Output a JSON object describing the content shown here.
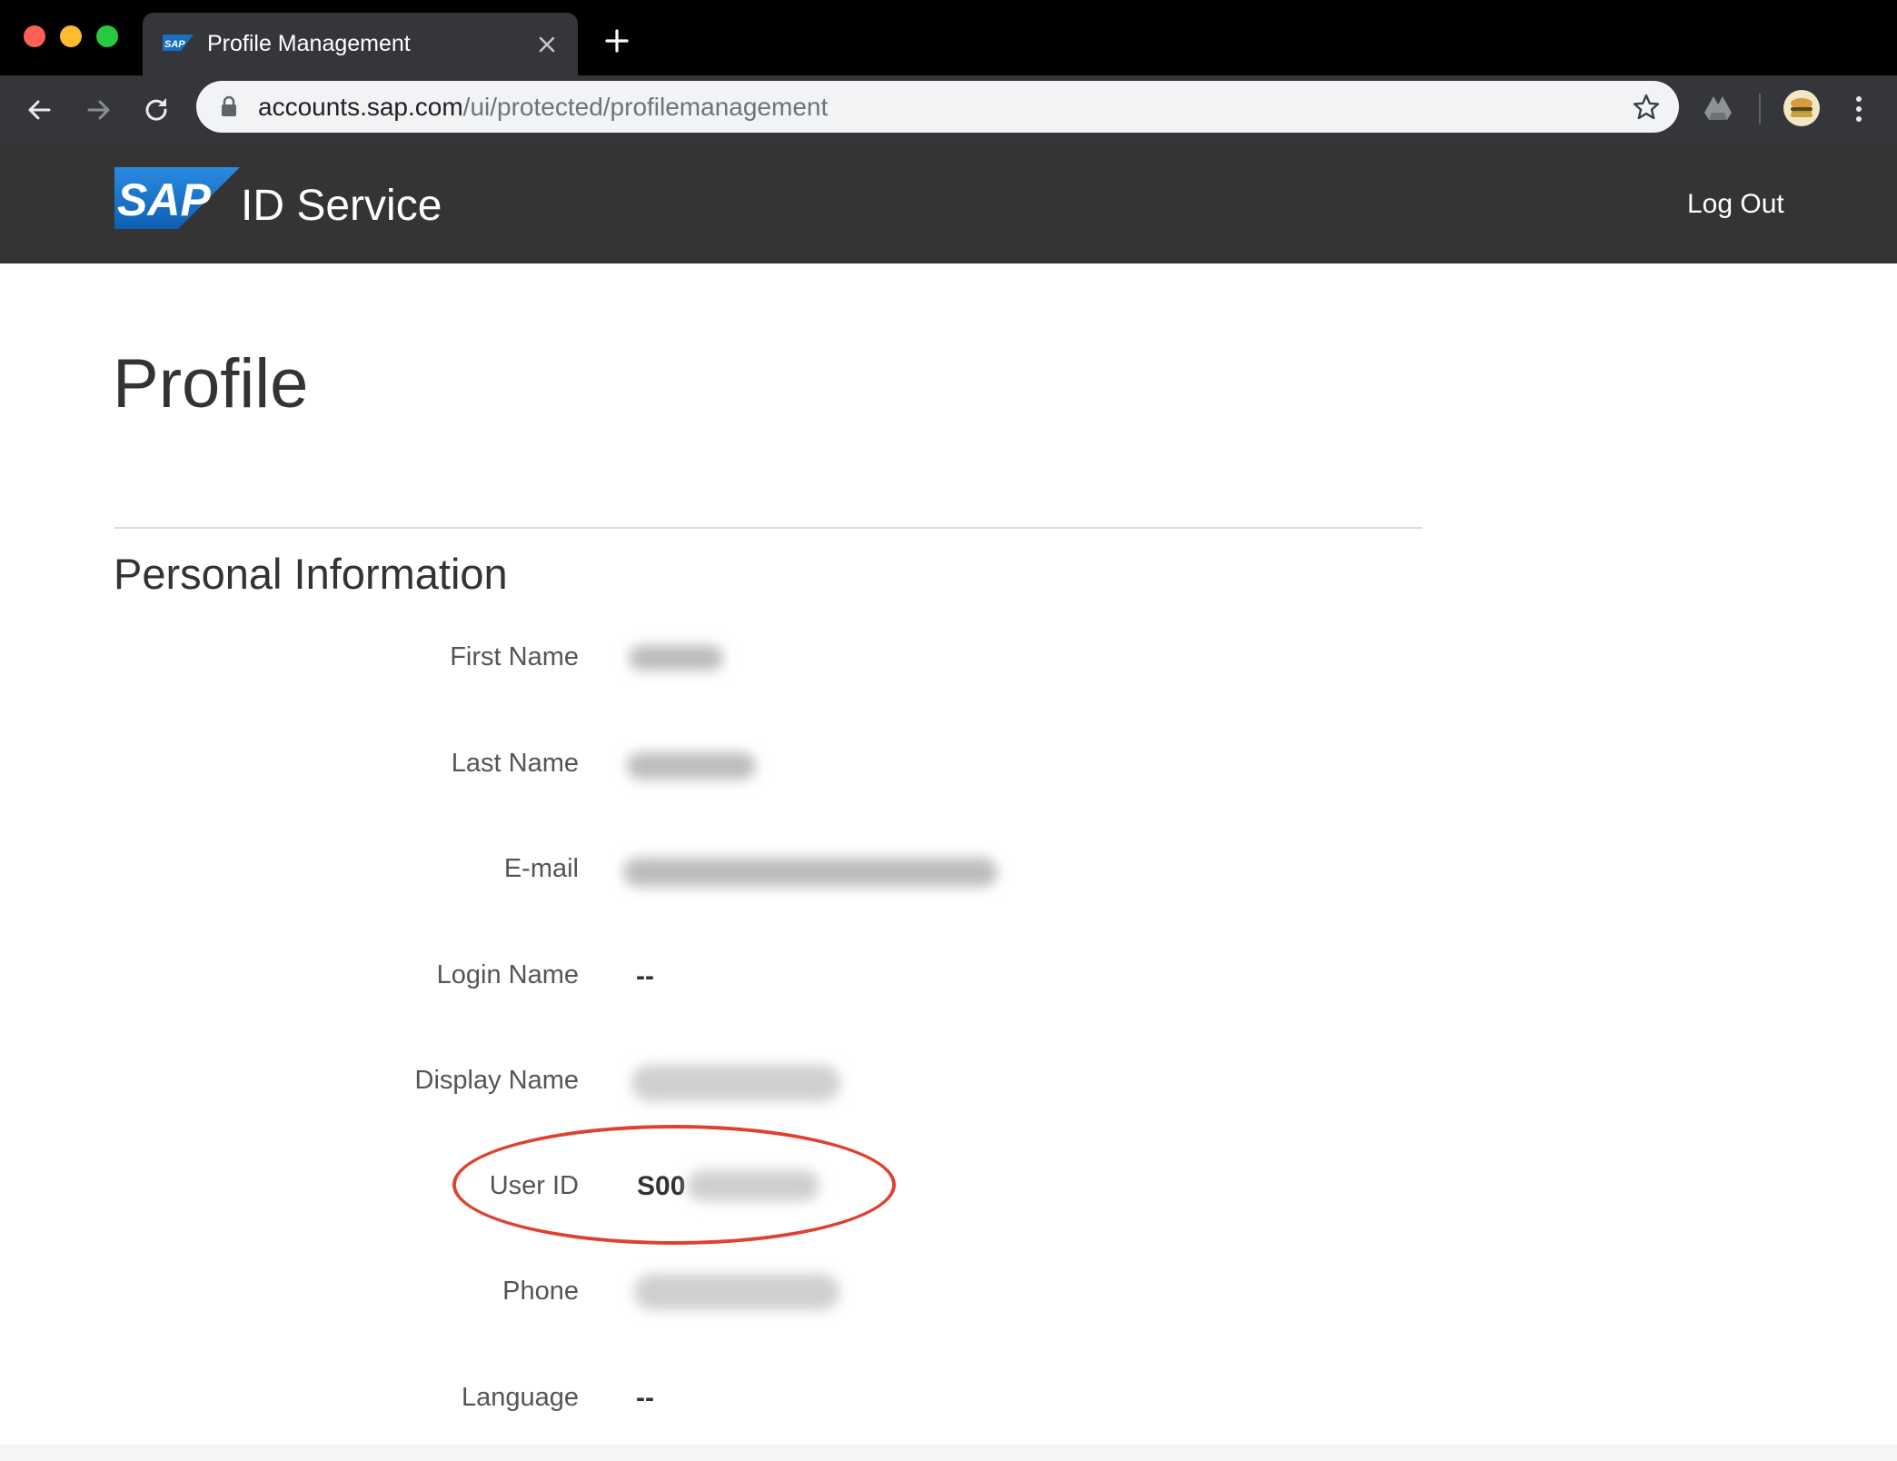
{
  "browser": {
    "tab_title": "Profile Management",
    "url_host": "accounts.sap.com",
    "url_path": "/ui/protected/profilemanagement",
    "icons": [
      "back-icon",
      "forward-icon",
      "reload-icon",
      "lock-icon",
      "star-icon",
      "drive-icon",
      "kebab-icon",
      "close-icon",
      "plus-icon"
    ]
  },
  "header": {
    "logo_text": "SAP",
    "service_title": "ID Service",
    "logout_label": "Log Out",
    "background": "#343434",
    "logo_color": "#1a6fc0"
  },
  "page": {
    "title": "Profile",
    "section_title": "Personal Information"
  },
  "fields": [
    {
      "label": "First Name",
      "value": ""
    },
    {
      "label": "Last Name",
      "value": ""
    },
    {
      "label": "E-mail",
      "value": ""
    },
    {
      "label": "Login Name",
      "value": "--"
    },
    {
      "label": "Display Name",
      "value": ""
    },
    {
      "label": "User ID",
      "value": "S00"
    },
    {
      "label": "Phone",
      "value": ""
    },
    {
      "label": "Language",
      "value": "--"
    }
  ],
  "annotation": {
    "color": "#e0402f"
  }
}
